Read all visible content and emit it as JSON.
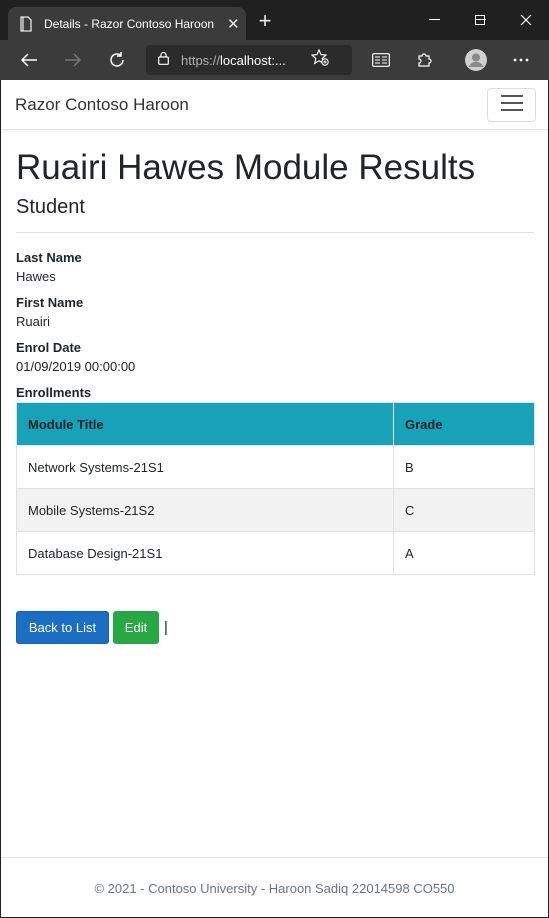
{
  "browser": {
    "tab_title": "Details - Razor Contoso Haroon",
    "url_prefix": "https://",
    "url_host": "localhost:..."
  },
  "navbar": {
    "brand": "Razor Contoso Haroon"
  },
  "page": {
    "title": "Ruairi Hawes Module Results",
    "subtitle": "Student"
  },
  "details": [
    {
      "label": "Last Name",
      "value": "Hawes"
    },
    {
      "label": "First Name",
      "value": "Ruairi"
    },
    {
      "label": "Enrol Date",
      "value": "01/09/2019 00:00:00"
    },
    {
      "label": "Enrollments",
      "value": ""
    }
  ],
  "table": {
    "headers": [
      "Module Title",
      "Grade"
    ],
    "rows": [
      [
        "Network Systems-21S1",
        "B"
      ],
      [
        "Mobile Systems-21S2",
        "C"
      ],
      [
        "Database Design-21S1",
        "A"
      ]
    ]
  },
  "actions": {
    "back_label": "Back to List",
    "edit_label": "Edit",
    "separator": "|"
  },
  "footer": {
    "text": "© 2021 - Contoso University - Haroon Sadiq 22014598 CO550"
  },
  "colors": {
    "table_header": "#17a2b8",
    "primary": "#1b6ec2",
    "success": "#28a745"
  }
}
